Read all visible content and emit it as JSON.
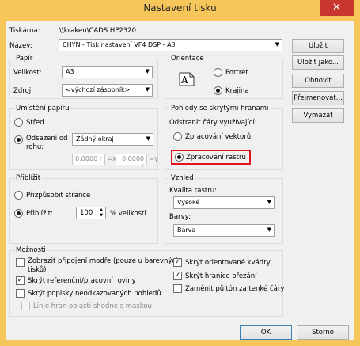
{
  "window": {
    "title": "Nastavení tisku",
    "close_label": "✕"
  },
  "printer": {
    "label": "Tiskárna:",
    "value": "\\\\kraken\\CADS HP2320"
  },
  "name": {
    "label": "Název:",
    "value": "CHYN - Tisk nastavení VF4 DSP - A3"
  },
  "side_buttons": [
    "Uložit",
    "Uložit jako...",
    "Obnovit",
    "Přejmenovat...",
    "Vymazat"
  ],
  "paper": {
    "title": "Papír",
    "size_label": "Velikost:",
    "size_value": "A3",
    "source_label": "Zdroj:",
    "source_value": "<výchozí zásobník>"
  },
  "orientation": {
    "title": "Orientace",
    "icon_glyph": "A",
    "portrait": "Portrét",
    "landscape": "Krajina",
    "selected": "landscape"
  },
  "placement": {
    "title": "Umístění papíru",
    "center": "Střed",
    "offset_line1": "Odsazení od",
    "offset_line2": "rohu:",
    "corner_value": "Žádný okraj",
    "x_value": "0.0000 r",
    "x_label": "=x",
    "y_value": "0.0000 r",
    "y_label": "=y",
    "selected": "offset"
  },
  "hidden_view": {
    "title": "Pohledy se skrytými hranami",
    "subtitle": "Odstranit čáry využívající:",
    "vector": "Zpracování vektorů",
    "raster": "Zpracování rastru",
    "selected": "raster"
  },
  "zoom": {
    "title": "Přiblížit",
    "fit": "Přizpůsobit stránce",
    "zoom_label": "Přiblížit:",
    "zoom_value": "100",
    "percent_label": "% velikosti",
    "selected": "zoom"
  },
  "shading": {
    "title": "Vzhled",
    "quality_label": "Kvalita rastru:",
    "quality_value": "Vysoké",
    "color_label": "Barvy:",
    "color_value": "Barva"
  },
  "options": {
    "title": "Možnosti",
    "left": [
      {
        "label": "Zobrazit připojení modře (pouze u barevných tisků)",
        "checked": false,
        "disabled": false
      },
      {
        "label": "Skrýt referenční/pracovní roviny",
        "checked": true,
        "disabled": false
      },
      {
        "label": "Skrýt popisky neodkazovaných pohledů",
        "checked": false,
        "disabled": false
      },
      {
        "label": "Linie hran oblasti shodné s maskou",
        "checked": false,
        "disabled": true
      }
    ],
    "right": [
      {
        "label": "Skrýt orientované kvádry",
        "checked": true
      },
      {
        "label": "Skrýt hranice ořezání",
        "checked": true
      },
      {
        "label": "Zaměnit půltón za tenké čáry",
        "checked": false
      }
    ]
  },
  "footer": {
    "ok": "OK",
    "cancel": "Storno"
  },
  "colors": {
    "frame": "#f6c65b",
    "close": "#c7372f",
    "highlight": "#e0141e"
  }
}
